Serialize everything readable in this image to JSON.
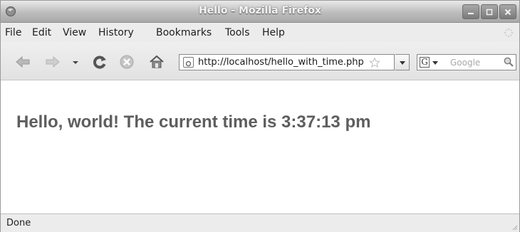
{
  "window": {
    "title": "Hello - Mozilla Firefox"
  },
  "menu": {
    "items": [
      "File",
      "Edit",
      "View",
      "History",
      "Bookmarks",
      "Tools",
      "Help"
    ]
  },
  "toolbar": {
    "icons": [
      "back-icon",
      "forward-icon",
      "dropdown-icon",
      "reload-icon",
      "stop-icon",
      "home-icon"
    ]
  },
  "url": {
    "value": "http://localhost/hello_with_time.php"
  },
  "search": {
    "engine": "G",
    "placeholder": "Google"
  },
  "page": {
    "heading": "Hello, world! The current time is 3:37:13 pm"
  },
  "status": {
    "text": "Done"
  }
}
